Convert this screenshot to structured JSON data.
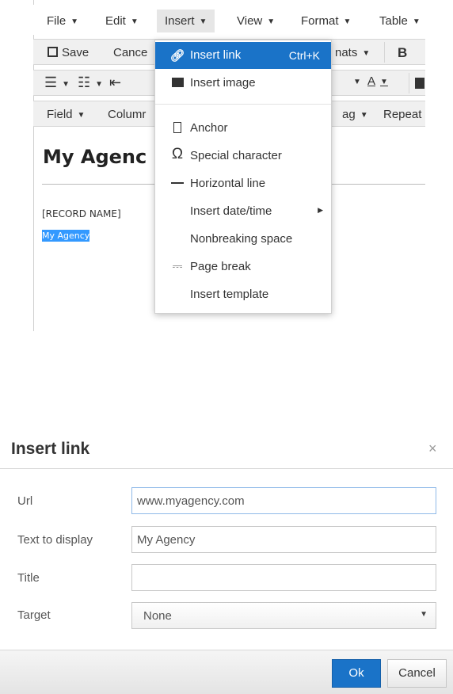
{
  "menubar": {
    "items": [
      {
        "label": "File"
      },
      {
        "label": "Edit"
      },
      {
        "label": "Insert"
      },
      {
        "label": "View"
      },
      {
        "label": "Format"
      },
      {
        "label": "Table"
      }
    ]
  },
  "toolbar1": {
    "save_label": "Save",
    "cancel_label": "Cance",
    "formats_label": "nats",
    "bold_label": "B"
  },
  "toolbar3": {
    "field_label": "Field",
    "columns_label": "Columr",
    "tag_label": "ag",
    "repeat_label": "Repeat"
  },
  "document": {
    "title": "My Agenc",
    "record_name": "[RECORD NAME]",
    "selected_text": "My Agency"
  },
  "dropdown": {
    "items": [
      {
        "label": "Insert link",
        "shortcut": "Ctrl+K",
        "icon": "link-icon"
      },
      {
        "label": "Insert image",
        "icon": "image-icon"
      },
      {
        "label": "Anchor",
        "icon": "bookmark-icon"
      },
      {
        "label": "Special character",
        "icon": "omega-icon"
      },
      {
        "label": "Horizontal line",
        "icon": "hr-icon"
      },
      {
        "label": "Insert date/time"
      },
      {
        "label": "Nonbreaking space"
      },
      {
        "label": "Page break",
        "icon": "page-break-icon"
      },
      {
        "label": "Insert template"
      }
    ]
  },
  "dialog": {
    "title": "Insert link",
    "close": "×",
    "url_label": "Url",
    "url_value": "www.myagency.com",
    "text_label": "Text to display",
    "text_value": "My Agency",
    "title_label": "Title",
    "title_value": "",
    "target_label": "Target",
    "target_value": "None",
    "ok_label": "Ok",
    "cancel_label": "Cancel"
  },
  "colors": {
    "accent": "#1a73c8",
    "selection": "#3399ff"
  }
}
